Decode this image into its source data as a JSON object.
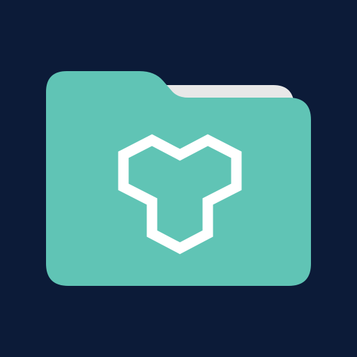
{
  "icon": {
    "name": "folder-icon",
    "emblem": "hexagon-cluster-emblem"
  },
  "colors": {
    "background": "#0c1b38",
    "folder": "#60c4b5",
    "paper": "#e8e8e8",
    "emblem": "#ffffff"
  }
}
